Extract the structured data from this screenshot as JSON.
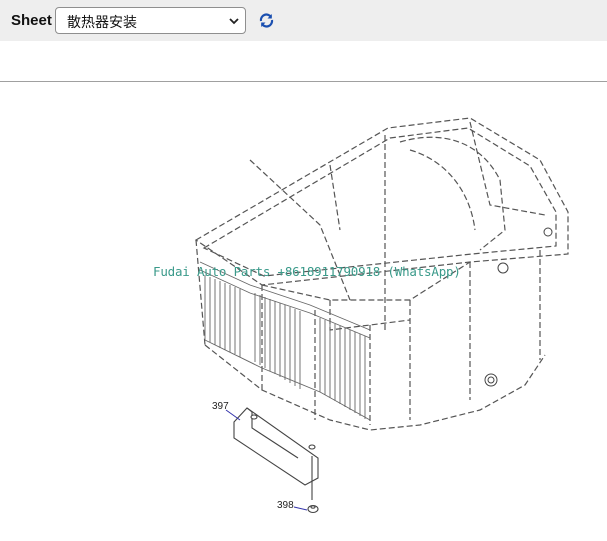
{
  "toolbar": {
    "sheet_label": "Sheet",
    "sheet_selected": "散热器安装",
    "refresh_icon": "refresh-icon"
  },
  "drawing": {
    "watermark": "Fudai Auto Parts +8618911790918 (WhatsApp)",
    "callouts": [
      "397",
      "398"
    ]
  },
  "colors": {
    "toolbar_bg": "#eeeeee",
    "watermark": "#3a9a8a",
    "leader_line": "#3333aa",
    "refresh_icon": "#1a4fb0"
  }
}
